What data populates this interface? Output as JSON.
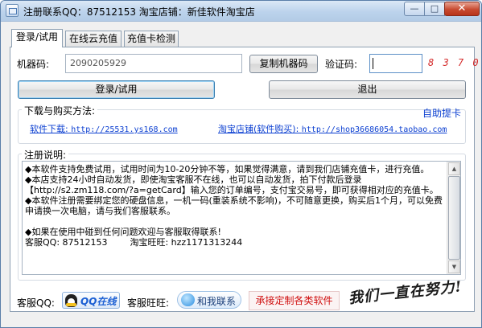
{
  "window": {
    "title": "注册联系QQ：87512153 淘宝店铺：新佳软件淘宝店",
    "min_glyph": "—",
    "max_glyph": "□",
    "close_glyph": "✕"
  },
  "tabs": [
    {
      "label": "登录/试用",
      "active": true
    },
    {
      "label": "在线云充值",
      "active": false
    },
    {
      "label": "充值卡检测",
      "active": false
    }
  ],
  "login": {
    "machine_code_label": "机器码:",
    "machine_code_value": "2090205929",
    "copy_button": "复制机器码",
    "captcha_label": "验证码:",
    "captcha_input_value": "",
    "captcha_text": "8 3 7 0",
    "login_button": "登录/试用",
    "exit_button": "退出"
  },
  "download": {
    "group_title": "下载与购买方法:",
    "auto_card_link": "自助提卡",
    "software_prefix": "软件下载: ",
    "software_url": "http://25531.ys168.com",
    "shop_prefix": "淘宝店铺(软件购买): ",
    "shop_url": "http://shop36686054.taobao.com"
  },
  "notes": {
    "group_title": "注册说明:",
    "lines": [
      "◆本软件支持免费试用，试用时间为10-20分钟不等，如果觉得满意，请到我们店铺充值卡，进行充值。",
      "◆本店支持24小时自动发货，即使淘宝客服不在线，也可以自动发货，拍下付款后登录【http://s2.zm118.com/?a=getCard】输入您的订单编号，支付宝交易号，即可获得相对应的充值卡。",
      "◆本软件注册需要绑定您的硬盘信息，一机一码(重装系统不影响)，不可随意更换，购买后1个月，可以免费申请换一次电脑，请与我们客服联系。",
      "",
      "◆如果在使用中碰到任何问题欢迎与客服取得联系!",
      "客服QQ: 87512153        淘宝旺旺: hzz1171313244"
    ]
  },
  "footer": {
    "qq_label": "客服QQ:",
    "qq_button": "QQ在线",
    "ww_label": "客服旺旺:",
    "ww_button": "和我联系",
    "custom_button": "承接定制各类软件",
    "signature": "我们一直在努力!"
  },
  "colors": {
    "link": "#0b3fd1",
    "captcha": "#d42a2a",
    "custom_text": "#d01010"
  }
}
